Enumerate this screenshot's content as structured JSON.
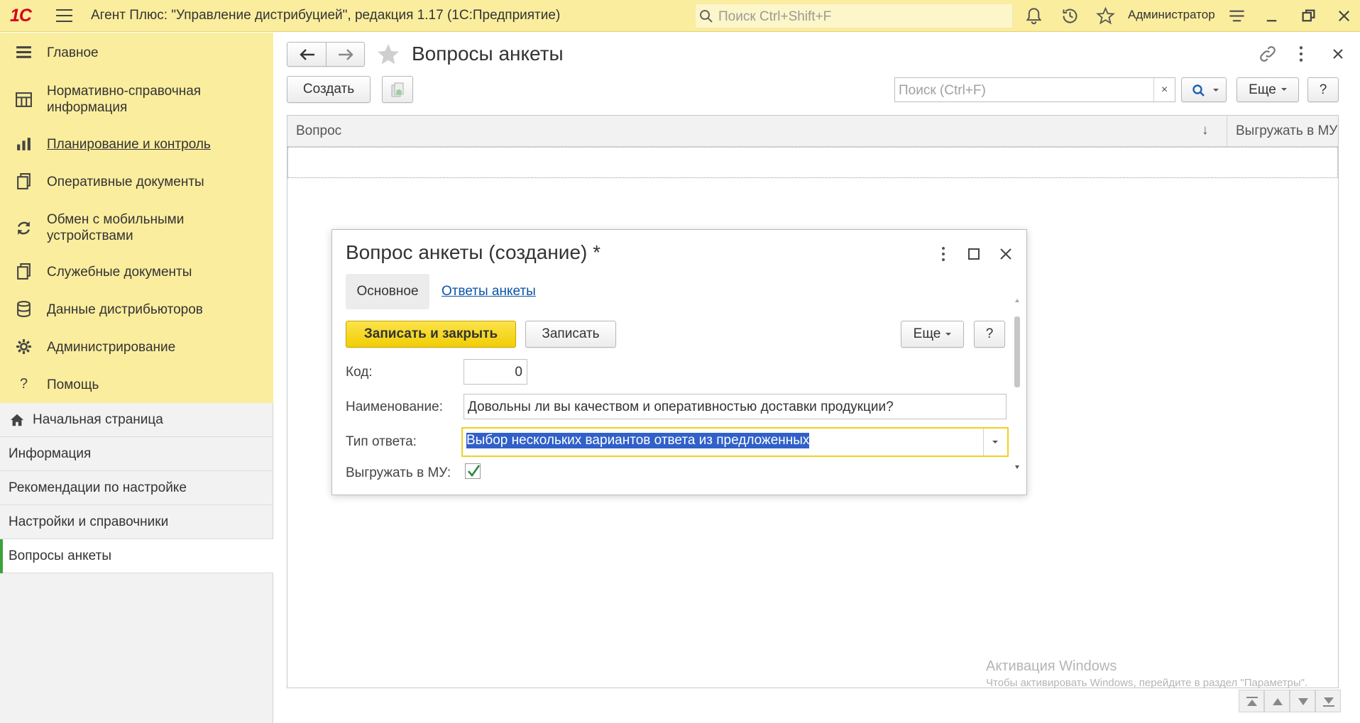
{
  "titlebar": {
    "logo": "1С",
    "title": "Агент Плюс: \"Управление дистрибуцией\", редакция 1.17  (1С:Предприятие)",
    "search_placeholder": "Поиск Ctrl+Shift+F",
    "user": "Администратор"
  },
  "sections": [
    {
      "label": "Главное",
      "icon": "menu-lines-icon"
    },
    {
      "label": "Нормативно-справочная информация",
      "icon": "grid-icon"
    },
    {
      "label": "Планирование и контроль",
      "icon": "bar-chart-icon"
    },
    {
      "label": "Оперативные документы",
      "icon": "documents-icon"
    },
    {
      "label": "Обмен с мобильными устройствами",
      "icon": "sync-icon"
    },
    {
      "label": "Служебные документы",
      "icon": "documents-icon"
    },
    {
      "label": "Данные дистрибьюторов",
      "icon": "database-icon"
    },
    {
      "label": "Администрирование",
      "icon": "gear-icon"
    },
    {
      "label": "Помощь",
      "icon": "question-icon"
    }
  ],
  "nav": [
    {
      "label": "Начальная страница",
      "icon": "home-icon"
    },
    {
      "label": "Информация"
    },
    {
      "label": "Рекомендации по настройке"
    },
    {
      "label": "Настройки и справочники"
    },
    {
      "label": "Вопросы анкеты"
    }
  ],
  "form": {
    "title": "Вопросы анкеты",
    "create_label": "Создать",
    "search_placeholder": "Поиск (Ctrl+F)",
    "search_clear": "×",
    "more_label": "Еще",
    "help_label": "?",
    "columns": [
      "Вопрос",
      "Выгружать в МУ"
    ],
    "sort_indicator": "↓"
  },
  "dialog": {
    "title": "Вопрос анкеты (создание) *",
    "tabs": [
      "Основное",
      "Ответы анкеты"
    ],
    "save_close_label": "Записать и закрыть",
    "save_label": "Записать",
    "more_label": "Еще",
    "help_label": "?",
    "fields": {
      "code_label": "Код:",
      "code_value": "0",
      "name_label": "Наименование:",
      "name_value": "Довольны ли вы качеством и оперативностью доставки продукции?",
      "type_label": "Тип ответа:",
      "type_value": "Выбор нескольких вариантов ответа из предложенных",
      "export_label": "Выгружать в МУ:",
      "export_checked": true
    }
  },
  "watermark": {
    "line1": "Активация Windows",
    "line2": "Чтобы активировать Windows, перейдите в раздел \"Параметры\"."
  }
}
